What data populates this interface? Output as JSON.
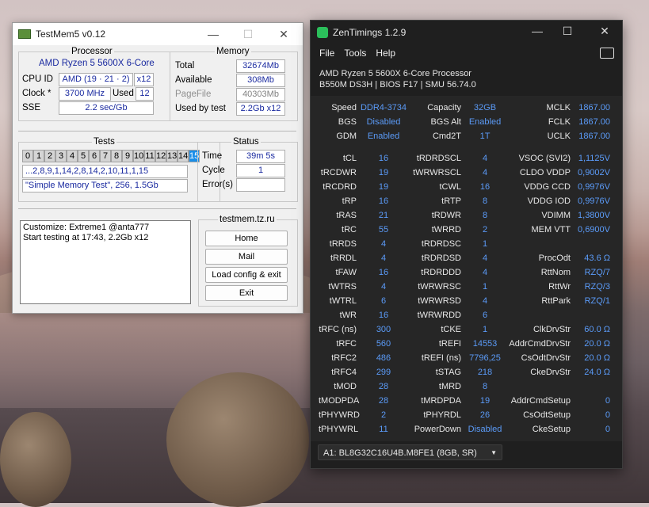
{
  "testmem": {
    "title": "TestMem5 v0.12",
    "processor": {
      "title": "Processor",
      "name": "AMD Ryzen 5 5600X 6-Core",
      "cpu_id_label": "CPU ID",
      "cpu_id_value": "AMD  (19 · 21 · 2)",
      "cpu_id_threads": "x12",
      "clock_label": "Clock *",
      "clock_value": "3700 MHz",
      "used_label": "Used",
      "used_value": "12",
      "sse_label": "SSE",
      "sse_value": "2.2 sec/Gb"
    },
    "memory": {
      "title": "Memory",
      "total_label": "Total",
      "total_value": "32674Mb",
      "available_label": "Available",
      "available_value": "308Mb",
      "pagefile_label": "PageFile",
      "pagefile_value": "40303Mb",
      "usedby_label": "Used by test",
      "usedby_value": "2.2Gb x12"
    },
    "tests": {
      "title": "Tests",
      "cells": [
        "0",
        "1",
        "2",
        "3",
        "4",
        "5",
        "6",
        "7",
        "8",
        "9",
        "10",
        "11",
        "12",
        "13",
        "14",
        "15"
      ],
      "active": "15",
      "sequence": "...2,8,9,1,14,2,8,14,2,10,11,1,15",
      "config": "\"Simple Memory Test\", 256, 1.5Gb"
    },
    "status": {
      "title": "Status",
      "time_label": "Time",
      "time_value": "39m 5s",
      "cycle_label": "Cycle",
      "cycle_value": "1",
      "errors_label": "Error(s)",
      "errors_value": ""
    },
    "log": {
      "line1": "Customize: Extreme1 @anta777",
      "line2": "Start testing at 17:43, 2.2Gb x12"
    },
    "site": {
      "title": "testmem.tz.ru",
      "home": "Home",
      "mail": "Mail",
      "load": "Load config & exit",
      "exit": "Exit"
    }
  },
  "zen": {
    "title": "ZenTimings 1.2.9",
    "menu": [
      "File",
      "Tools",
      "Help"
    ],
    "cpu": "AMD Ryzen 5 5600X 6-Core Processor",
    "board": "B550M DS3H | BIOS F17 | SMU 56.74.0",
    "top": [
      {
        "k1": "Speed",
        "v1": "DDR4-3734",
        "k2": "Capacity",
        "v2": "32GB",
        "k3": "MCLK",
        "v3": "1867.00"
      },
      {
        "k1": "BGS",
        "v1": "Disabled",
        "k2": "BGS Alt",
        "v2": "Enabled",
        "k3": "FCLK",
        "v3": "1867.00"
      },
      {
        "k1": "GDM",
        "v1": "Enabled",
        "k2": "Cmd2T",
        "v2": "1T",
        "k3": "UCLK",
        "v3": "1867.00"
      }
    ],
    "rows": [
      {
        "k1": "tCL",
        "v1": "16",
        "k2": "tRDRDSCL",
        "v2": "4",
        "k3": "VSOC (SVI2)",
        "v3": "1,1125V"
      },
      {
        "k1": "tRCDWR",
        "v1": "19",
        "k2": "tWRWRSCL",
        "v2": "4",
        "k3": "CLDO VDDP",
        "v3": "0,9002V"
      },
      {
        "k1": "tRCDRD",
        "v1": "19",
        "k2": "tCWL",
        "v2": "16",
        "k3": "VDDG CCD",
        "v3": "0,9976V"
      },
      {
        "k1": "tRP",
        "v1": "16",
        "k2": "tRTP",
        "v2": "8",
        "k3": "VDDG IOD",
        "v3": "0,9976V"
      },
      {
        "k1": "tRAS",
        "v1": "21",
        "k2": "tRDWR",
        "v2": "8",
        "k3": "VDIMM",
        "v3": "1,3800V"
      },
      {
        "k1": "tRC",
        "v1": "55",
        "k2": "tWRRD",
        "v2": "2",
        "k3": "MEM VTT",
        "v3": "0,6900V"
      },
      {
        "k1": "tRRDS",
        "v1": "4",
        "k2": "tRDRDSC",
        "v2": "1",
        "k3": "",
        "v3": ""
      },
      {
        "k1": "tRRDL",
        "v1": "4",
        "k2": "tRDRDSD",
        "v2": "4",
        "k3": "ProcOdt",
        "v3": "43.6 Ω"
      },
      {
        "k1": "tFAW",
        "v1": "16",
        "k2": "tRDRDDD",
        "v2": "4",
        "k3": "RttNom",
        "v3": "RZQ/7"
      },
      {
        "k1": "tWTRS",
        "v1": "4",
        "k2": "tWRWRSC",
        "v2": "1",
        "k3": "RttWr",
        "v3": "RZQ/3"
      },
      {
        "k1": "tWTRL",
        "v1": "6",
        "k2": "tWRWRSD",
        "v2": "4",
        "k3": "RttPark",
        "v3": "RZQ/1"
      },
      {
        "k1": "tWR",
        "v1": "16",
        "k2": "tWRWRDD",
        "v2": "6",
        "k3": "",
        "v3": ""
      },
      {
        "k1": "tRFC (ns)",
        "v1": "300",
        "k2": "tCKE",
        "v2": "1",
        "k3": "ClkDrvStr",
        "v3": "60.0 Ω"
      },
      {
        "k1": "tRFC",
        "v1": "560",
        "k2": "tREFI",
        "v2": "14553",
        "k3": "AddrCmdDrvStr",
        "v3": "20.0 Ω"
      },
      {
        "k1": "tRFC2",
        "v1": "486",
        "k2": "tREFI (ns)",
        "v2": "7796,25",
        "k3": "CsOdtDrvStr",
        "v3": "20.0 Ω"
      },
      {
        "k1": "tRFC4",
        "v1": "299",
        "k2": "tSTAG",
        "v2": "218",
        "k3": "CkeDrvStr",
        "v3": "24.0 Ω"
      },
      {
        "k1": "tMOD",
        "v1": "28",
        "k2": "tMRD",
        "v2": "8",
        "k3": "",
        "v3": ""
      },
      {
        "k1": "tMODPDA",
        "v1": "28",
        "k2": "tMRDPDA",
        "v2": "19",
        "k3": "AddrCmdSetup",
        "v3": "0"
      },
      {
        "k1": "tPHYWRD",
        "v1": "2",
        "k2": "tPHYRDL",
        "v2": "26",
        "k3": "CsOdtSetup",
        "v3": "0"
      },
      {
        "k1": "tPHYWRL",
        "v1": "11",
        "k2": "PowerDown",
        "v2": "Disabled",
        "k3": "CkeSetup",
        "v3": "0"
      }
    ],
    "dimm": "A1: BL8G32C16U4B.M8FE1 (8GB, SR)"
  }
}
